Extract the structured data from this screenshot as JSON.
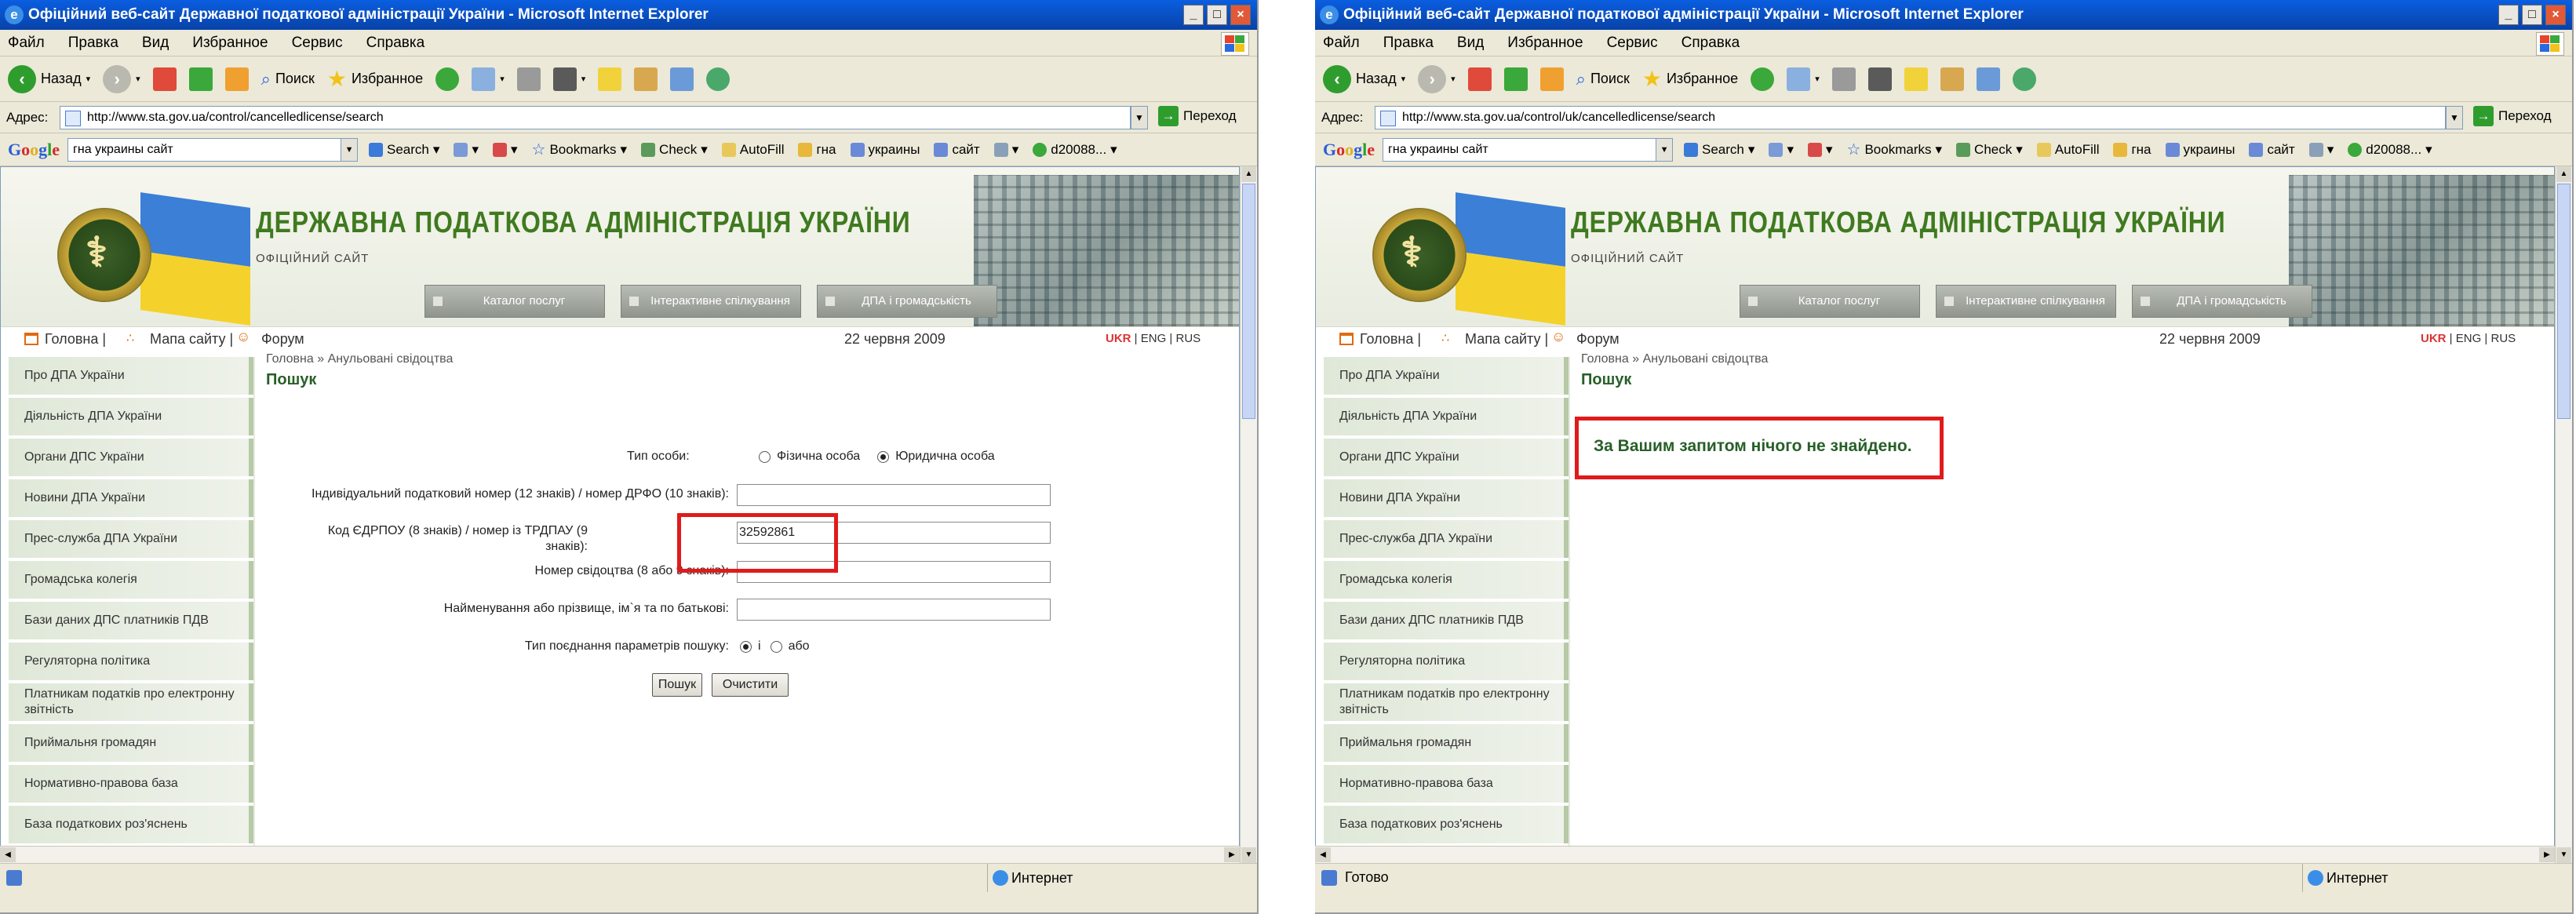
{
  "left": {
    "window_title": "Офіційний веб-сайт Державної податкової адміністрації України - Microsoft Internet Explorer",
    "menu": [
      "Файл",
      "Правка",
      "Вид",
      "Избранное",
      "Сервис",
      "Справка"
    ],
    "toolbar": {
      "back": "Назад",
      "search": "Поиск",
      "favorites": "Избранное"
    },
    "address_label": "Адрес:",
    "url": "http://www.sta.gov.ua/control/cancelledlicense/search",
    "go_label": "Переход",
    "google": {
      "query": "гна украины сайт",
      "search": "Search",
      "bookmarks": "Bookmarks",
      "check": "Check",
      "autofill": "AutoFill",
      "gna": "гна",
      "ukrainy": "украины",
      "sait": "сайт",
      "account": "d20088..."
    },
    "site_title": "ДЕРЖАВНА ПОДАТКОВА АДМІНІСТРАЦІЯ УКРАЇНИ",
    "site_subtitle": "ОФІЦІЙНИЙ САЙТ",
    "tabs": [
      "Каталог послуг",
      "Інтерактивне спілкування",
      "ДПА і громадськість"
    ],
    "nav": {
      "home": "Головна |",
      "sitemap": "Мапа сайту |",
      "forum": "Форум",
      "date": "22 червня 2009",
      "ukr": "UKR",
      "sep1": " | ",
      "eng": "ENG",
      "sep2": " | ",
      "rus": "RUS"
    },
    "breadcrumb": "Головна »  Анульовані свідоцтва",
    "heading": "Пошук",
    "sidebar": [
      "Про ДПА України",
      "Діяльність ДПА України",
      "Органи ДПС України",
      "Новини ДПА України",
      "Прес-служба ДПА України",
      "Громадська колегія",
      "Бази даних ДПС платників ПДВ",
      "Регуляторна політика",
      "Платникам податків про електронну звітність",
      "Приймальня громадян",
      "Нормативно-правова база",
      "База податкових роз'яснень"
    ],
    "form": {
      "person_type_label": "Тип особи:",
      "natural_person": "Фізична особа",
      "legal_person": "Юридична особа",
      "tax_id_label": "Індивідуальний податковий номер (12 знаків) / номер ДРФО (10 знаків):",
      "edrpou_label": "Код ЄДРПОУ (8 знаків) / номер із ТРДПАУ (9 знаків):",
      "edrpou_value": "32592861",
      "cert_label": "Номер свідоцтва (8 або 9 знаків):",
      "name_label": "Найменування або прізвище, ім`я та по батькові:",
      "combine_label": "Тип поєднання параметрів пошуку:",
      "and_label": "і",
      "or_label": "або",
      "search_button": "Пошук",
      "clear_button": "Очистити"
    },
    "status_zone": "Интернет"
  },
  "right": {
    "window_title": "Офіційний веб-сайт Державної податкової адміністрації України - Microsoft Internet Explorer",
    "url": "http://www.sta.gov.ua/control/uk/cancelledlicense/search",
    "result_message": "За Вашим запитом нічого не знайдено.",
    "status_left": "Готово",
    "status_zone": "Интернет"
  },
  "colors": {
    "title_bar": "#0a5ee0",
    "site_green": "#3f7a1f",
    "highlight_red": "#e01b1b",
    "lang_active": "#d33"
  },
  "icons": [
    "ie-icon",
    "back-icon",
    "forward-icon",
    "stop-icon",
    "refresh-icon",
    "home-icon",
    "search-icon",
    "favorites-star-icon",
    "history-icon",
    "mail-icon",
    "print-icon",
    "page-icon",
    "go-arrow-icon",
    "globe-icon",
    "emblem-icon",
    "flag-icon",
    "sitemap-icon",
    "forum-icon"
  ]
}
